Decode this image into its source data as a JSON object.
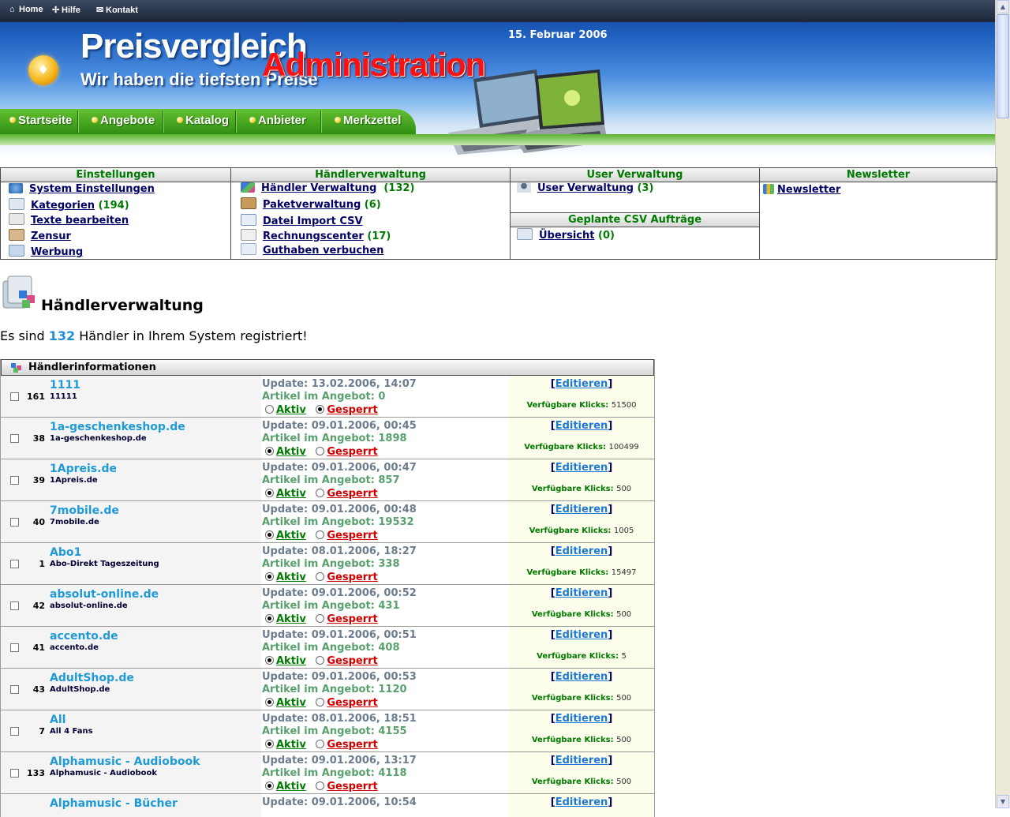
{
  "topnav": [
    {
      "label": "Home",
      "icon": "house-icon"
    },
    {
      "label": "Hilfe",
      "icon": "help-icon"
    },
    {
      "label": "Kontakt",
      "icon": "mail-icon"
    }
  ],
  "header": {
    "date": "15. Februar 2006",
    "brand_title": "Preisvergleich",
    "brand_slogan": "Wir haben die tiefsten Preise",
    "brand_admin": "Administration"
  },
  "mainnav": [
    "Startseite",
    "Angebote",
    "Katalog",
    "Anbieter",
    "Merkzettel"
  ],
  "menu": {
    "einstellungen": {
      "title": "Einstellungen",
      "items": [
        {
          "label": "System Einstellungen",
          "count": ""
        },
        {
          "label": "Kategorien",
          "count": "194"
        },
        {
          "label": "Texte bearbeiten",
          "count": ""
        },
        {
          "label": "Zensur",
          "count": ""
        },
        {
          "label": "Werbung",
          "count": ""
        }
      ]
    },
    "haendler": {
      "title": "Händlerverwaltung",
      "items": [
        {
          "label": "Händler Verwaltung",
          "count": "132"
        },
        {
          "label": "Paketverwaltung",
          "count": "6"
        },
        {
          "label": "Datei Import CSV",
          "count": ""
        },
        {
          "label": "Rechnungscenter",
          "count": "17"
        },
        {
          "label": "Guthaben verbuchen",
          "count": ""
        }
      ]
    },
    "user": {
      "title": "User Verwaltung",
      "items": [
        {
          "label": "User Verwaltung",
          "count": "3"
        }
      ]
    },
    "csv": {
      "title": "Geplante CSV Aufträge",
      "items": [
        {
          "label": "Übersicht",
          "count": "0"
        }
      ]
    },
    "newsletter": {
      "title": "Newsletter",
      "items": [
        {
          "label": "Newsletter",
          "count": ""
        }
      ]
    }
  },
  "section": {
    "title": "Händlerverwaltung",
    "summary_pre": "Es sind ",
    "summary_count": "132",
    "summary_post": " Händler in Ihrem System registriert!"
  },
  "grid": {
    "header": "Händlerinformationen",
    "labels": {
      "aktiv": "Aktiv",
      "gesperrt": "Gesperrt",
      "edit": "Editieren",
      "klicks": "Verfügbare Klicks:"
    },
    "rows": [
      {
        "id": "161",
        "name": "1111",
        "sub": "11111",
        "update": "Update: 13.02.2006, 14:07",
        "artikel": "Artikel im Angebot: 0",
        "status": "gesperrt",
        "klicks": "51500"
      },
      {
        "id": "38",
        "name": "1a-geschenkeshop.de",
        "sub": "1a-geschenkeshop.de",
        "update": "Update: 09.01.2006, 00:45",
        "artikel": "Artikel im Angebot: 1898",
        "status": "aktiv",
        "klicks": "100499"
      },
      {
        "id": "39",
        "name": "1Apreis.de",
        "sub": "1Apreis.de",
        "update": "Update: 09.01.2006, 00:47",
        "artikel": "Artikel im Angebot: 857",
        "status": "aktiv",
        "klicks": "500"
      },
      {
        "id": "40",
        "name": "7mobile.de",
        "sub": "7mobile.de",
        "update": "Update: 09.01.2006, 00:48",
        "artikel": "Artikel im Angebot: 19532",
        "status": "aktiv",
        "klicks": "1005"
      },
      {
        "id": "1",
        "name": "Abo1",
        "sub": "Abo-Direkt Tageszeitung",
        "update": "Update: 08.01.2006, 18:27",
        "artikel": "Artikel im Angebot: 338",
        "status": "aktiv",
        "klicks": "15497"
      },
      {
        "id": "42",
        "name": "absolut-online.de",
        "sub": "absolut-online.de",
        "update": "Update: 09.01.2006, 00:52",
        "artikel": "Artikel im Angebot: 431",
        "status": "aktiv",
        "klicks": "500"
      },
      {
        "id": "41",
        "name": "accento.de",
        "sub": "accento.de",
        "update": "Update: 09.01.2006, 00:51",
        "artikel": "Artikel im Angebot: 408",
        "status": "aktiv",
        "klicks": "5"
      },
      {
        "id": "43",
        "name": "AdultShop.de",
        "sub": "AdultShop.de",
        "update": "Update: 09.01.2006, 00:53",
        "artikel": "Artikel im Angebot: 1120",
        "status": "aktiv",
        "klicks": "500"
      },
      {
        "id": "7",
        "name": "All",
        "sub": "All 4 Fans",
        "update": "Update: 08.01.2006, 18:51",
        "artikel": "Artikel im Angebot: 4155",
        "status": "aktiv",
        "klicks": "500"
      },
      {
        "id": "133",
        "name": "Alphamusic - Audiobook",
        "sub": "Alphamusic - Audiobook",
        "update": "Update: 09.01.2006, 13:17",
        "artikel": "Artikel im Angebot: 4118",
        "status": "aktiv",
        "klicks": "500"
      },
      {
        "id": "",
        "name": "Alphamusic - Bücher",
        "sub": "",
        "update": "Update: 09.01.2006, 10:54",
        "artikel": "",
        "status": "",
        "klicks": ""
      }
    ]
  }
}
